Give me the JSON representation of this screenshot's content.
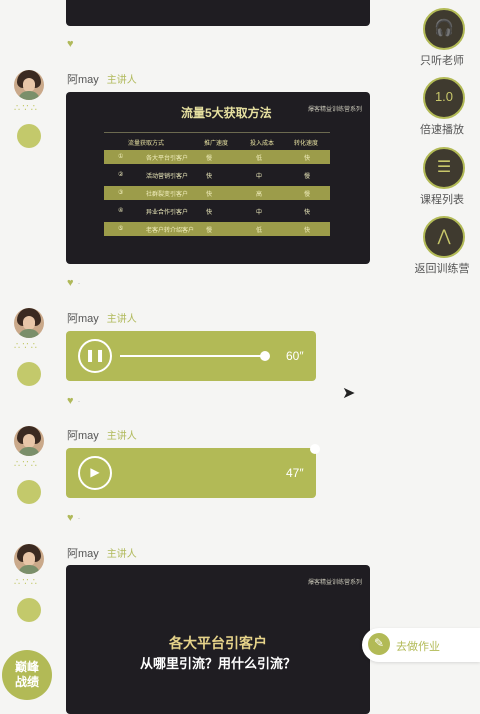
{
  "side_nav": [
    {
      "label": "只听老师",
      "icon": "headphones-icon",
      "glyph": "🎧"
    },
    {
      "label": "倍速播放",
      "icon": "speed-icon",
      "glyph": "1.0"
    },
    {
      "label": "课程列表",
      "icon": "list-icon",
      "glyph": "☰"
    },
    {
      "label": "返回训练营",
      "icon": "return-icon",
      "glyph": "⋀"
    }
  ],
  "messages": [
    {
      "name": "阿may",
      "role": "主讲人"
    },
    {
      "name": "阿may",
      "role": "主讲人"
    },
    {
      "name": "阿may",
      "role": "主讲人"
    },
    {
      "name": "阿may",
      "role": "主讲人"
    }
  ],
  "slide_table": {
    "title": "流量5大获取方法",
    "brand": "爆客精益训练营系列",
    "headers": [
      "流量获取方式",
      "推广速度",
      "投入成本",
      "转化速度"
    ],
    "rows": [
      {
        "n": "①",
        "method": "各大平台引客户",
        "speed": "慢",
        "cost": "低",
        "conv": "快"
      },
      {
        "n": "②",
        "method": "活动营销引客户",
        "speed": "快",
        "cost": "中",
        "conv": "慢"
      },
      {
        "n": "③",
        "method": "社群裂变引客户",
        "speed": "快",
        "cost": "高",
        "conv": "慢"
      },
      {
        "n": "④",
        "method": "异业合作引客户",
        "speed": "快",
        "cost": "中",
        "conv": "快"
      },
      {
        "n": "⑤",
        "method": "老客户转介绍客户",
        "speed": "慢",
        "cost": "低",
        "conv": "快"
      }
    ]
  },
  "audio": [
    {
      "duration": "60″",
      "progress": 1.0
    },
    {
      "duration": "47″",
      "progress": 0.0
    }
  ],
  "slide_bottom": {
    "brand": "爆客精益训练营系列",
    "line1": "各大平台引客户",
    "line2": "从哪里引流？用什么引流？"
  },
  "homework": {
    "label": "去做作业"
  },
  "corner_badge": {
    "line1": "巅峰",
    "line2": "战绩"
  },
  "colors": {
    "accent": "#b2ba56",
    "slide_bg": "#1f1d22",
    "fab_bg": "#3f3a2f"
  }
}
